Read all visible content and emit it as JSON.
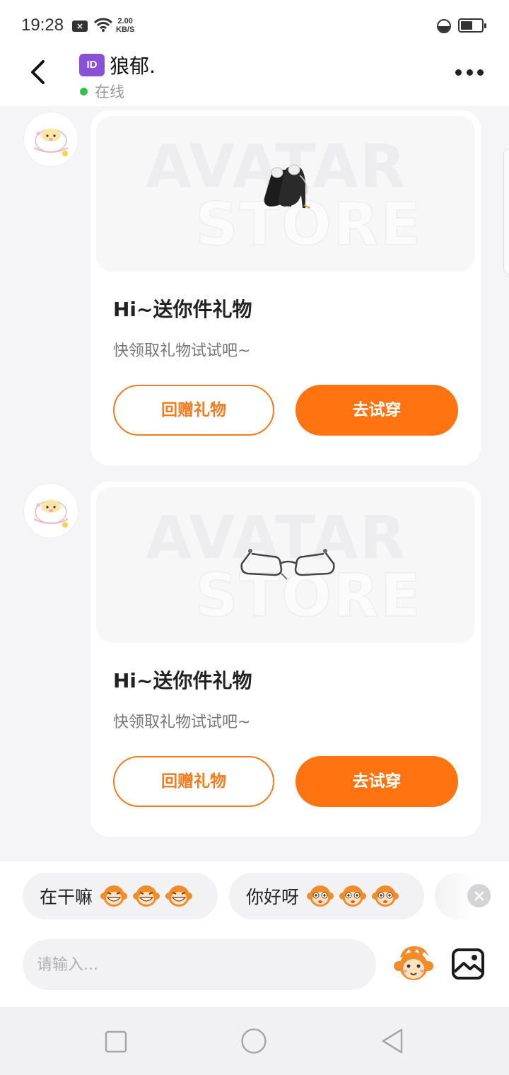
{
  "status_bar": {
    "time": "19:28",
    "speed_value": "2.00",
    "speed_unit": "KB/S"
  },
  "header": {
    "id_badge": "ID",
    "name": "狼郁.",
    "status": "在线",
    "status_color": "#31c24a"
  },
  "messages": [
    {
      "watermark_top": "AVATAR",
      "watermark_bottom": "STORE",
      "item_icon": "heels-icon",
      "title": "Hi~送你件礼物",
      "subtitle": "快领取礼物试试吧~",
      "return_gift_label": "回赠礼物",
      "try_on_label": "去试穿"
    },
    {
      "watermark_top": "AVATAR",
      "watermark_bottom": "STORE",
      "item_icon": "glasses-icon",
      "title": "Hi~送你件礼物",
      "subtitle": "快领取礼物试试吧~",
      "return_gift_label": "回赠礼物",
      "try_on_label": "去试穿"
    }
  ],
  "quick_replies": [
    {
      "text": "在干嘛"
    },
    {
      "text": "你好呀"
    }
  ],
  "input": {
    "placeholder": "请输入..."
  },
  "colors": {
    "accent": "#ff7411",
    "accent_outline": "#f47b1e"
  }
}
